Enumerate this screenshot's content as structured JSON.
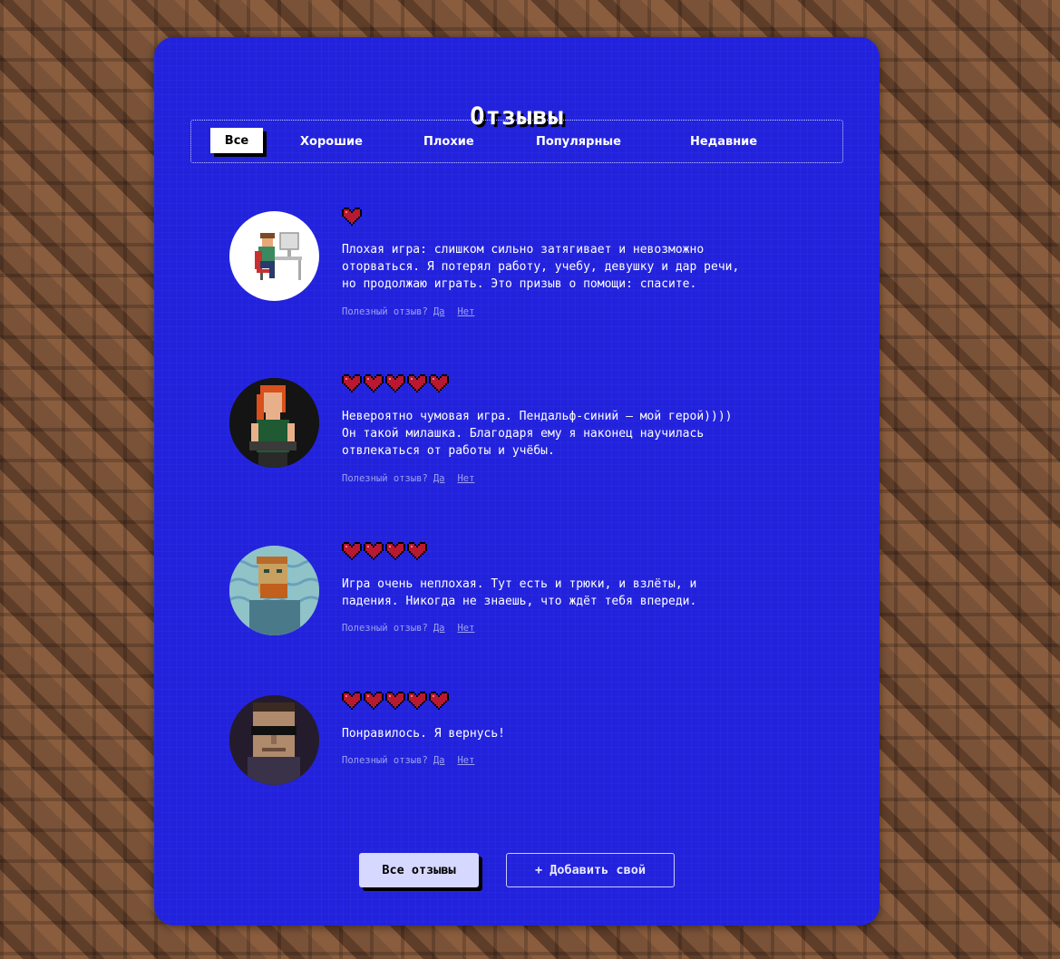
{
  "page": {
    "title": "Отзывы"
  },
  "tabs": [
    {
      "label": "Все",
      "active": true
    },
    {
      "label": "Хорошие"
    },
    {
      "label": "Плохие"
    },
    {
      "label": "Популярные"
    },
    {
      "label": "Недавние"
    }
  ],
  "reviews": [
    {
      "rating": 1,
      "text": "Плохая игра: слишком сильно затягивает и невозможно\nоторваться. Я потерял работу, учебу, девушку и дар речи,\nно продолжаю играть. Это призыв о помощи: спасите.",
      "helpful": "Полезный отзыв?",
      "yes": "Да",
      "no": "Нет"
    },
    {
      "rating": 5,
      "text": "Невероятно чумовая игра. Пендальф-синий — мой герой))))\nОн такой милашка. Благодаря ему я наконец научилась\nотвлекаться от работы и учёбы.",
      "helpful": "Полезный отзыв?",
      "yes": "Да",
      "no": "Нет"
    },
    {
      "rating": 4,
      "text": "Игра очень неплохая. Тут есть и трюки, и взлёты, и\nпадения. Никогда не знаешь, что ждёт тебя впереди.",
      "helpful": "Полезный отзыв?",
      "yes": "Да",
      "no": "Нет"
    },
    {
      "rating": 5,
      "text": "Понравилось. Я вернусь!",
      "helpful": "Полезный отзыв?",
      "yes": "Да",
      "no": "Нет"
    }
  ],
  "buttons": {
    "all": "Все отзывы",
    "add": "+ Добавить свой"
  },
  "colors": {
    "panel": "#2222dd",
    "heart": "#b81830",
    "accent": "#ffffff"
  }
}
